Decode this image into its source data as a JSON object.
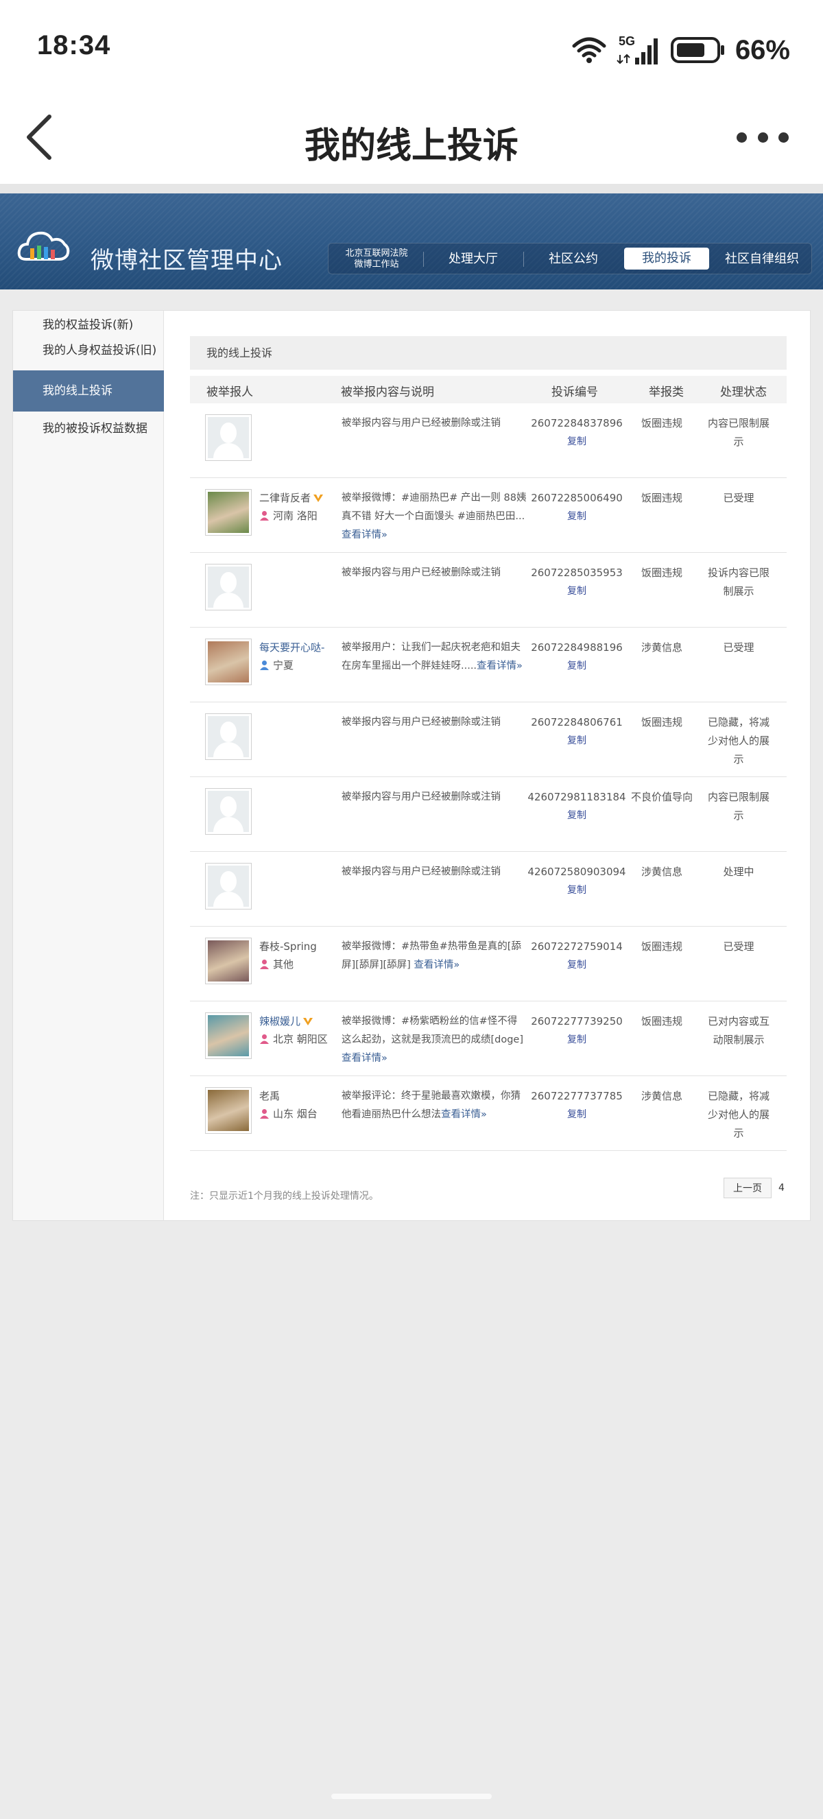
{
  "status_bar": {
    "time": "18:34",
    "network": "5G",
    "battery": "66%"
  },
  "header": {
    "title": "我的线上投诉"
  },
  "banner": {
    "title": "微博社区管理中心",
    "nav": [
      {
        "label": "北京互联网法院\n微博工作站"
      },
      {
        "label": "处理大厅"
      },
      {
        "label": "社区公约"
      },
      {
        "label": "我的投诉"
      },
      {
        "label": "社区自律组织"
      }
    ],
    "colors": {
      "banner": "#2f5a88",
      "active_sidebar": "#52739a",
      "link": "#3a5f94"
    }
  },
  "sidebar": {
    "items": [
      {
        "label": "我的权益投诉(新)"
      },
      {
        "label": "我的人身权益投诉(旧)"
      },
      {
        "label": "我的线上投诉"
      },
      {
        "label": "我的被投诉权益数据"
      }
    ]
  },
  "main": {
    "title": "我的线上投诉",
    "columns": [
      "被举报人",
      "被举报内容与说明",
      "投诉编号",
      "举报类",
      "处理状态"
    ],
    "copy_label": "复制",
    "rows": [
      {
        "name": "",
        "location": "",
        "desc": "被举报内容与用户已经被删除或注销",
        "more": "",
        "id": "26072284837896",
        "type": "饭圈违规",
        "status": "内容已限制展示"
      },
      {
        "name": "二律背反者",
        "location": "河南 洛阳",
        "desc": "被举报微博：#迪丽热巴# 产出一则 88姨真不错 好大一个白面馒头 #迪丽热巴田...",
        "more": "查看详情»",
        "id": "26072285006490",
        "type": "饭圈违规",
        "status": "已受理"
      },
      {
        "name": "",
        "location": "",
        "desc": "被举报内容与用户已经被删除或注销",
        "more": "",
        "id": "26072285035953",
        "type": "饭圈违规",
        "status": "投诉内容已限制展示"
      },
      {
        "name": "每天要开心哒-",
        "location": "宁夏",
        "desc": "被举报用户：让我们一起庆祝老疤和姐夫在房车里摇出一个胖娃娃呀.....",
        "more": "查看详情»",
        "id": "26072284988196",
        "type": "涉黄信息",
        "status": "已受理"
      },
      {
        "name": "",
        "location": "",
        "desc": "被举报内容与用户已经被删除或注销",
        "more": "",
        "id": "26072284806761",
        "type": "饭圈违规",
        "status": "已隐藏，将减少对他人的展示"
      },
      {
        "name": "",
        "location": "",
        "desc": "被举报内容与用户已经被删除或注销",
        "more": "",
        "id": "426072981183184",
        "type": "不良价值导向",
        "status": "内容已限制展示"
      },
      {
        "name": "",
        "location": "",
        "desc": "被举报内容与用户已经被删除或注销",
        "more": "",
        "id": "426072580903094",
        "type": "涉黄信息",
        "status": "处理中"
      },
      {
        "name": "春枝-Spring",
        "location": "其他",
        "desc": "被举报微博：#热带鱼#热带鱼是真的[舔屏][舔屏][舔屏] ",
        "more": "查看详情»",
        "id": "26072272759014",
        "type": "饭圈违规",
        "status": "已受理"
      },
      {
        "name": "辣椒媛儿",
        "location": "北京 朝阳区",
        "desc": "被举报微博：#杨紫晒粉丝的信#怪不得这么起劲，这就是我顶流巴的成绩[doge] ",
        "more": "查看详情»",
        "id": "26072277739250",
        "type": "饭圈违规",
        "status": "已对内容或互动限制展示"
      },
      {
        "name": "老禹",
        "location": "山东 烟台",
        "desc": "被举报评论：终于星驰最喜欢嫩模，你猜他看迪丽热巴什么想法",
        "more": "查看详情»",
        "id": "26072277737785",
        "type": "涉黄信息",
        "status": "已隐藏，将减少对他人的展示"
      }
    ],
    "footer_note": "注：只显示近1个月我的线上投诉处理情况。",
    "pager": {
      "prev": "上一页",
      "page": "4"
    }
  }
}
